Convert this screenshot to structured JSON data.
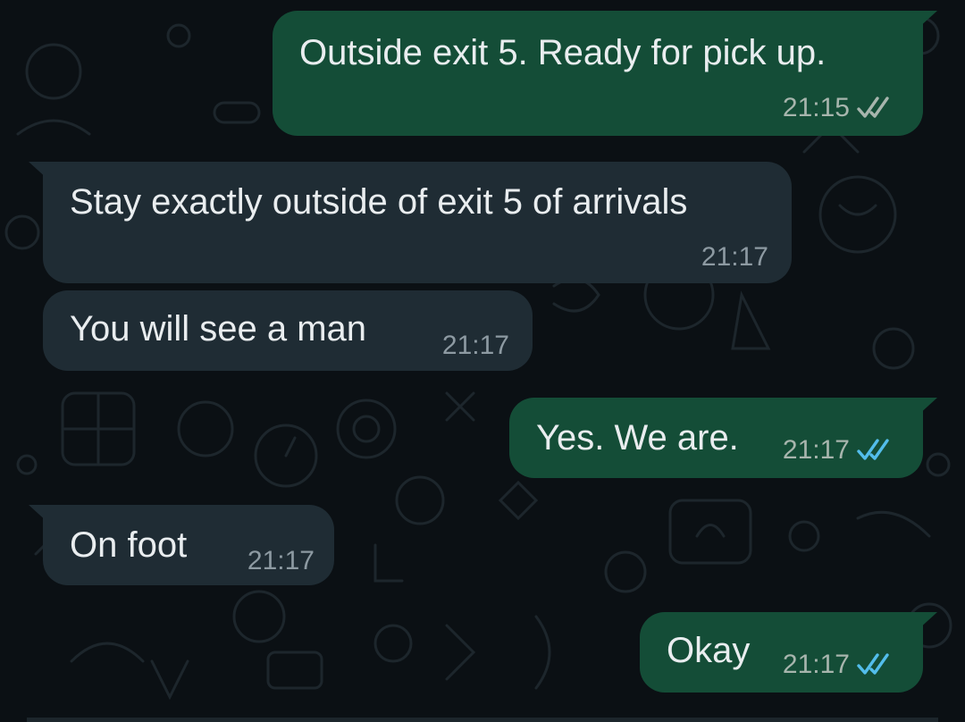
{
  "colors": {
    "background": "#0b1014",
    "outgoing_bubble": "#144d37",
    "incoming_bubble": "#1f2c34",
    "text": "#e9edef",
    "read_ticks": "#53bdeb",
    "delivered_ticks": "#a7b5ad"
  },
  "messages": [
    {
      "direction": "outgoing",
      "text": "Outside exit 5.  Ready for pick up.",
      "time": "21:15",
      "status": "delivered",
      "status_icon": "double-check-icon"
    },
    {
      "direction": "incoming",
      "text": "Stay exactly outside of exit 5 of arrivals",
      "time": "21:17"
    },
    {
      "direction": "incoming",
      "text": "You will see a man",
      "time": "21:17"
    },
    {
      "direction": "outgoing",
      "text": "Yes. We are.",
      "time": "21:17",
      "status": "read",
      "status_icon": "double-check-icon"
    },
    {
      "direction": "incoming",
      "text": "On foot",
      "time": "21:17"
    },
    {
      "direction": "outgoing",
      "text": "Okay",
      "time": "21:17",
      "status": "read",
      "status_icon": "double-check-icon"
    }
  ]
}
